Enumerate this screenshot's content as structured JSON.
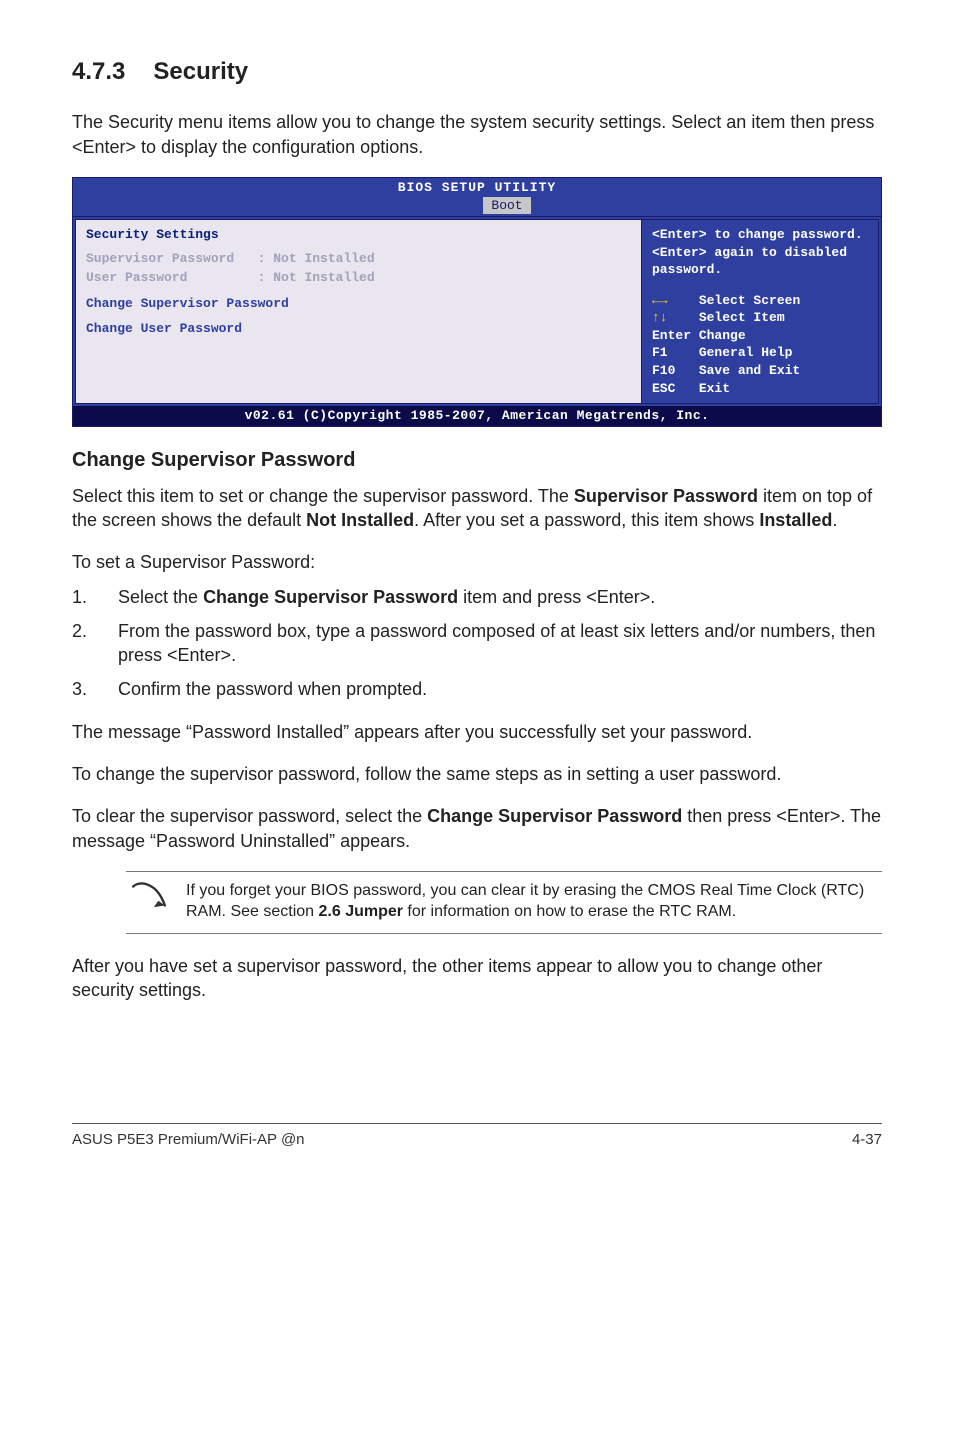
{
  "section": {
    "number": "4.7.3",
    "title": "Security"
  },
  "intro": "The Security menu items allow you to change the system security settings. Select an item then press <Enter> to display the configuration options.",
  "bios": {
    "title": "BIOS SETUP UTILITY",
    "tab": "Boot",
    "left": {
      "heading": "Security Settings",
      "row1_label": "Supervisor Password",
      "row1_value": ": Not Installed",
      "row2_label": "User Password",
      "row2_value": ": Not Installed",
      "item1": "Change Supervisor Password",
      "item2": "Change User Password"
    },
    "right": {
      "hint": "<Enter> to change password.\n<Enter> again to disabled password.",
      "k1": "Select Screen",
      "k2": "Select Item",
      "k3_l": "Enter",
      "k3_r": "Change",
      "k4_l": "F1",
      "k4_r": "General Help",
      "k5_l": "F10",
      "k5_r": "Save and Exit",
      "k6_l": "ESC",
      "k6_r": "Exit"
    },
    "footer": "v02.61 (C)Copyright 1985-2007, American Megatrends, Inc."
  },
  "sub1_title": "Change Supervisor Password",
  "sub1_p1_a": "Select this item to set or change the supervisor password. The ",
  "sub1_p1_b": "Supervisor Password",
  "sub1_p1_c": " item on top of the screen shows the default ",
  "sub1_p1_d": "Not Installed",
  "sub1_p1_e": ". After you set a password, this item shows ",
  "sub1_p1_f": "Installed",
  "sub1_p1_g": ".",
  "sub1_p2": "To set a Supervisor Password:",
  "steps": {
    "s1_a": "Select the ",
    "s1_b": "Change Supervisor Password",
    "s1_c": " item and press <Enter>.",
    "s2": "From the password box, type a password composed of at least six letters and/or numbers, then press <Enter>.",
    "s3": "Confirm the password when prompted."
  },
  "p_after_steps_1": "The message “Password Installed” appears after you successfully set your password.",
  "p_after_steps_2": "To change the supervisor password, follow the same steps as in setting a user password.",
  "p_after_steps_3a": "To clear the supervisor password, select the ",
  "p_after_steps_3b": "Change Supervisor Password",
  "p_after_steps_3c": " then press <Enter>. The message “Password Uninstalled” appears.",
  "note_a": "If you forget your BIOS password, you can clear it by erasing the CMOS Real Time Clock (RTC) RAM. See section ",
  "note_b": "2.6 Jumper",
  "note_c": " for information on how to erase the RTC RAM.",
  "p_final": "After you have set a supervisor password, the other items appear to allow you to change other security settings.",
  "footer_left": "ASUS P5E3 Premium/WiFi-AP @n",
  "footer_right": "4-37",
  "nums": {
    "n1": "1.",
    "n2": "2.",
    "n3": "3."
  }
}
